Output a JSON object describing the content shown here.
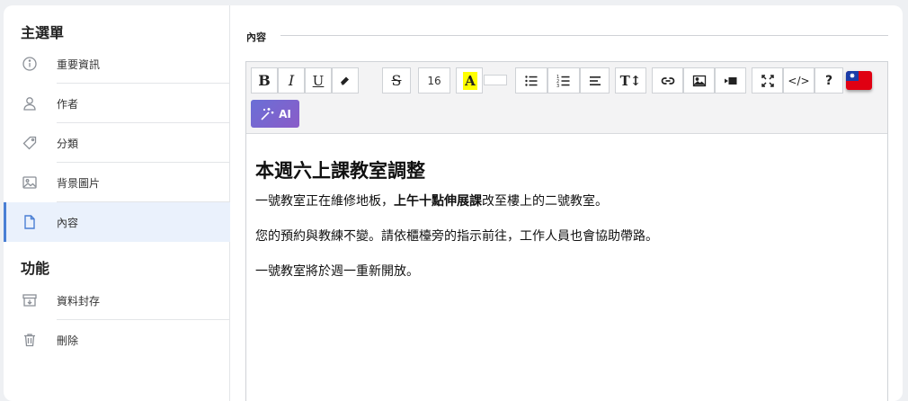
{
  "sidebar": {
    "sections": [
      {
        "title": "主選單",
        "items": [
          {
            "label": "重要資訊",
            "icon": "info-icon"
          },
          {
            "label": "作者",
            "icon": "user-icon"
          },
          {
            "label": "分類",
            "icon": "tag-icon"
          },
          {
            "label": "背景圖片",
            "icon": "image-icon"
          },
          {
            "label": "內容",
            "icon": "document-icon",
            "active": true
          }
        ]
      },
      {
        "title": "功能",
        "items": [
          {
            "label": "資料封存",
            "icon": "archive-icon"
          },
          {
            "label": "刪除",
            "icon": "trash-icon"
          }
        ]
      }
    ]
  },
  "main": {
    "section_label": "內容",
    "toolbar": {
      "bold": "B",
      "italic": "I",
      "underline": "U",
      "strikethrough": "S",
      "font_size": "16",
      "highlight": "A",
      "text_size": "T↕",
      "code": "</>",
      "help": "?",
      "language_flag": "taiwan-flag",
      "ai_label": "AI",
      "highlight_color": "#ffff00"
    },
    "document": {
      "title": "本週六上課教室調整",
      "p1_before": "一號教室正在維修地板，",
      "p1_bold": "上午十點伸展課",
      "p1_after": "改至樓上的二號教室。",
      "p2": "您的預約與教練不變。請依櫃檯旁的指示前往，工作人員也會協助帶路。",
      "p3": "一號教室將於週一重新開放。"
    }
  },
  "colors": {
    "accent": "#4a7fd4",
    "active_bg": "#eaf1fc",
    "ai_gradient_start": "#6a6fd6",
    "ai_gradient_end": "#8a5cc8"
  }
}
